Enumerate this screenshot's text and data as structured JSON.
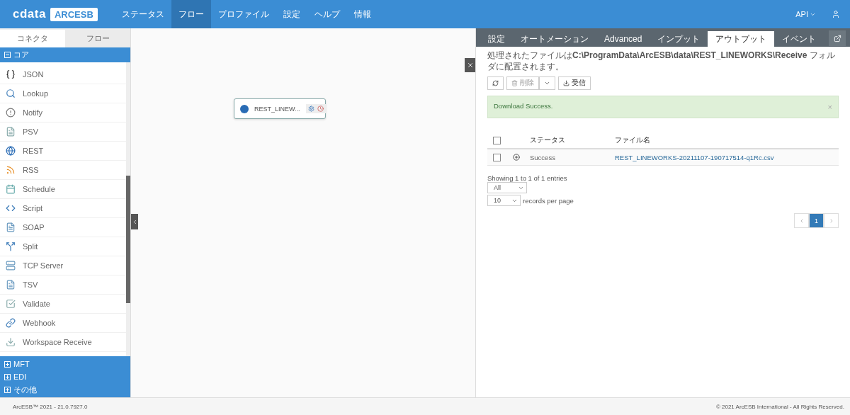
{
  "header": {
    "logo_left": "cdata",
    "logo_right": "ARCESB",
    "nav": [
      {
        "label": "ステータス",
        "selected": false
      },
      {
        "label": "フロー",
        "selected": true
      },
      {
        "label": "プロファイル",
        "selected": false
      },
      {
        "label": "設定",
        "selected": false
      },
      {
        "label": "ヘルプ",
        "selected": false
      },
      {
        "label": "情報",
        "selected": false
      }
    ],
    "api_menu": "API"
  },
  "sidebar": {
    "tabs": [
      {
        "label": "コネクタ",
        "selected": true
      },
      {
        "label": "フロー",
        "selected": false
      }
    ],
    "core": {
      "label": "コア",
      "expanded": true
    },
    "items": [
      {
        "label": "JSON"
      },
      {
        "label": "Lookup"
      },
      {
        "label": "Notify"
      },
      {
        "label": "PSV"
      },
      {
        "label": "REST"
      },
      {
        "label": "RSS"
      },
      {
        "label": "Schedule"
      },
      {
        "label": "Script"
      },
      {
        "label": "SOAP"
      },
      {
        "label": "Split"
      },
      {
        "label": "TCP Server"
      },
      {
        "label": "TSV"
      },
      {
        "label": "Validate"
      },
      {
        "label": "Webhook"
      },
      {
        "label": "Workspace Receive"
      }
    ],
    "categories": [
      {
        "label": "MFT",
        "expanded": false
      },
      {
        "label": "EDI",
        "expanded": false
      },
      {
        "label": "その他",
        "expanded": false
      }
    ]
  },
  "canvas": {
    "node": {
      "label": "REST_LINEW..."
    }
  },
  "panel": {
    "tabs": [
      {
        "label": "設定",
        "selected": false
      },
      {
        "label": "オートメーション",
        "selected": false
      },
      {
        "label": "Advanced",
        "selected": false
      },
      {
        "label": "インプット",
        "selected": false
      },
      {
        "label": "アウトプット",
        "selected": true
      },
      {
        "label": "イベント",
        "selected": false
      }
    ],
    "info": "処理されたファイルは**C:\\ProgramData\\ArcESB\\data\\REST_LINEWORKS\\Receive** フォルダに配置されます。",
    "buttons": {
      "delete": "削除",
      "receive": "受信"
    },
    "alert": "Download Success.",
    "alert_close": "×",
    "table": {
      "all_checked": false,
      "columns": [
        "ステータス",
        "ファイル名"
      ],
      "rows": [
        {
          "checked": false,
          "status": "Success",
          "file": "REST_LINEWORKS-20211107-190717514-q1Rc.csv"
        }
      ]
    },
    "summary": "Showing 1 to 1 of 1 entries",
    "filter": "All",
    "page_size": "10",
    "page_size_label": "records per page",
    "pages": [
      {
        "label": "1",
        "selected": true
      }
    ]
  },
  "footer": {
    "left": "ArcESB™ 2021 - 21.0.7927.0",
    "right": "© 2021 ArcESB International - All Rights Reserved."
  }
}
